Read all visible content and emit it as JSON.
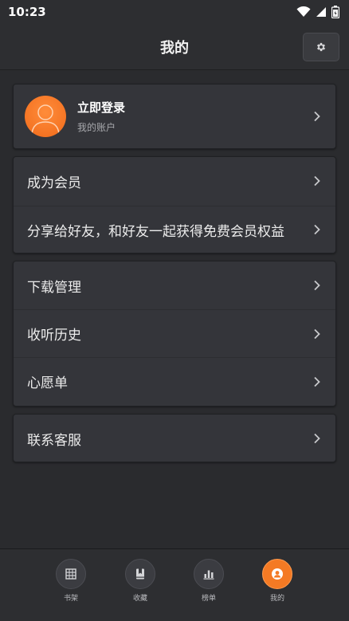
{
  "status_bar": {
    "time": "10:23"
  },
  "header": {
    "title": "我的"
  },
  "profile": {
    "login": "立即登录",
    "account": "我的账户"
  },
  "menu_group_1": [
    "成为会员",
    "分享给好友，和好友一起获得免费会员权益"
  ],
  "menu_group_2": [
    "下载管理",
    "收听历史",
    "心愿单"
  ],
  "menu_group_3": [
    "联系客服"
  ],
  "bottom_nav": [
    {
      "label": "书架",
      "icon": "bookshelf-icon"
    },
    {
      "label": "收藏",
      "icon": "bookmark-book-icon"
    },
    {
      "label": "榜单",
      "icon": "bar-chart-icon"
    },
    {
      "label": "我的",
      "icon": "user-icon"
    }
  ],
  "colors": {
    "accent": "#f47a24",
    "background": "#2a2b2e",
    "card": "#34353a"
  }
}
